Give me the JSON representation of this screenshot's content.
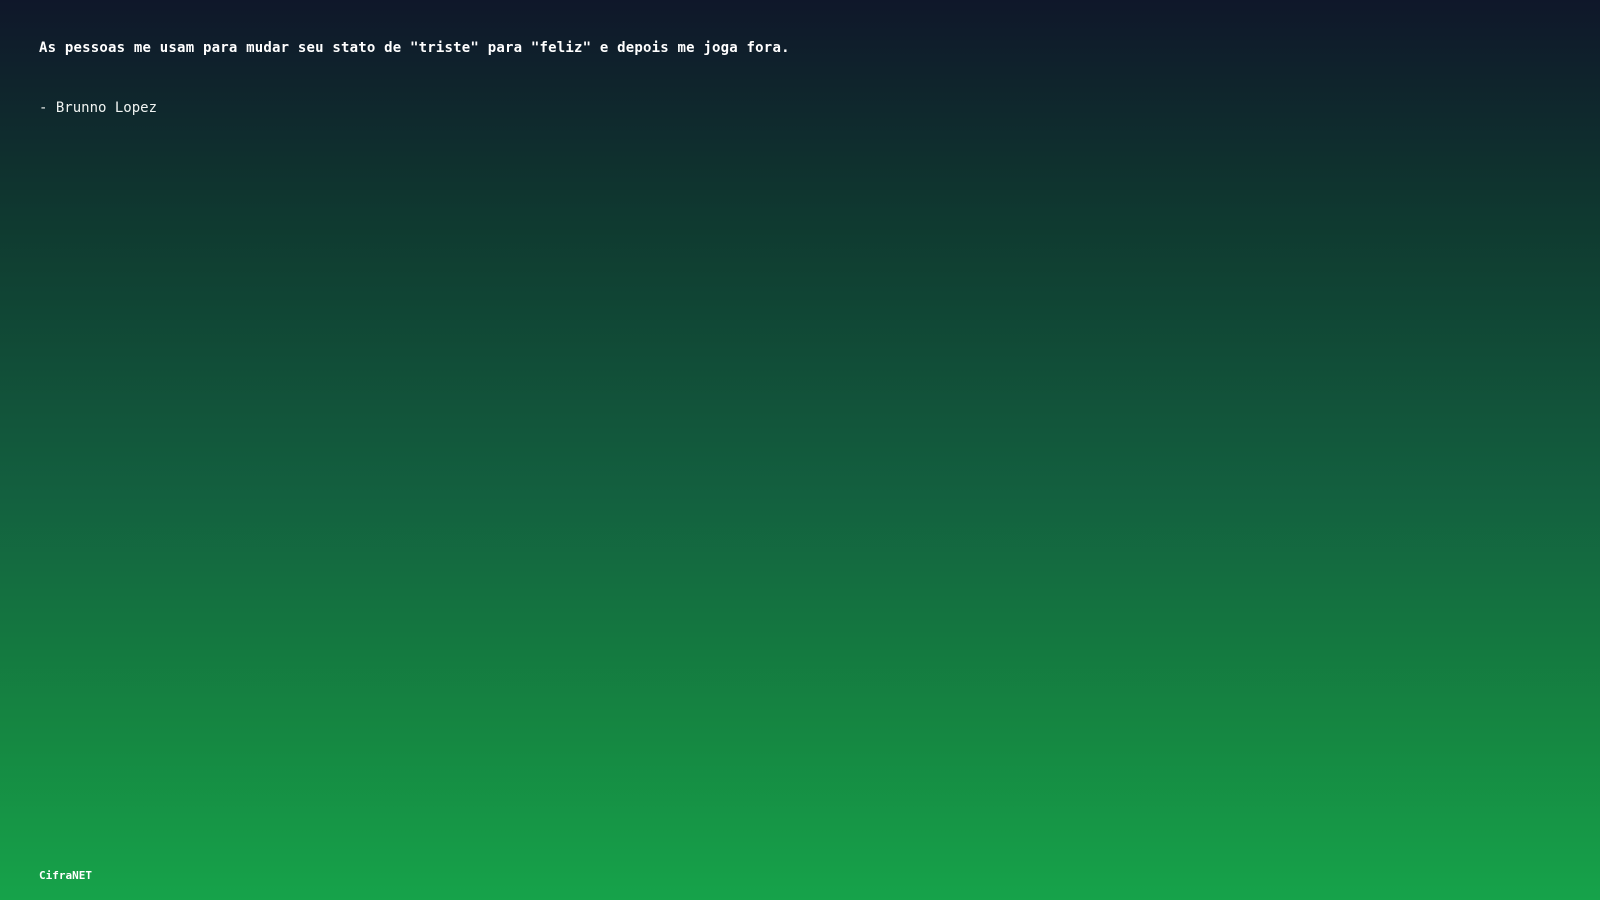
{
  "quote": {
    "text": "As pessoas me usam para mudar seu stato de \"triste\" para \"feliz\" e depois me joga fora.",
    "author": "- Brunno Lopez"
  },
  "footer": {
    "brand": "CifraNET"
  },
  "colors": {
    "gradient_top": "#0f172a",
    "gradient_bottom": "#16a34a",
    "text": "#ffffff"
  }
}
